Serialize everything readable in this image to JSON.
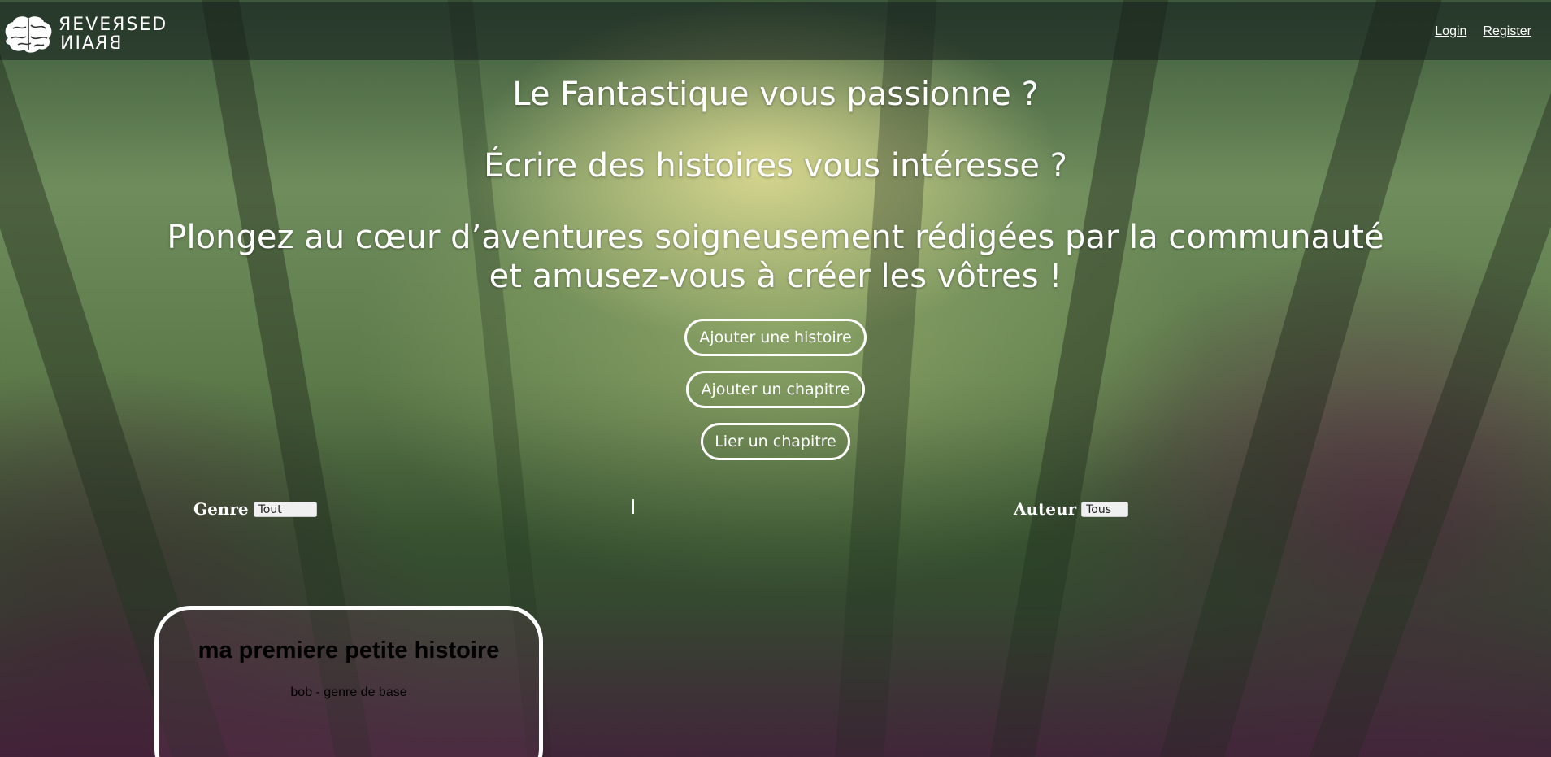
{
  "brand": {
    "line1": "ЯEVEЯSED",
    "line2": "BRAIN"
  },
  "nav": {
    "login": "Login",
    "register": "Register"
  },
  "hero": {
    "line1": "Le Fantastique vous passionne ?",
    "line2": "Écrire des histoires vous intéresse ?",
    "line3a": "Plongez au cœur d’aventures soigneusement rédigées par la communauté",
    "line3b": "et amusez-vous à créer les vôtres !"
  },
  "actions": {
    "add_story": "Ajouter une histoire",
    "add_chapter": "Ajouter un chapitre",
    "link_chapter": "Lier un chapitre"
  },
  "filters": {
    "genre_label": "Genre",
    "genre_value": "Tout",
    "author_label": "Auteur",
    "author_value": "Tous"
  },
  "stories": [
    {
      "title": "ma premiere petite histoire",
      "meta": "bob - genre de base"
    }
  ]
}
